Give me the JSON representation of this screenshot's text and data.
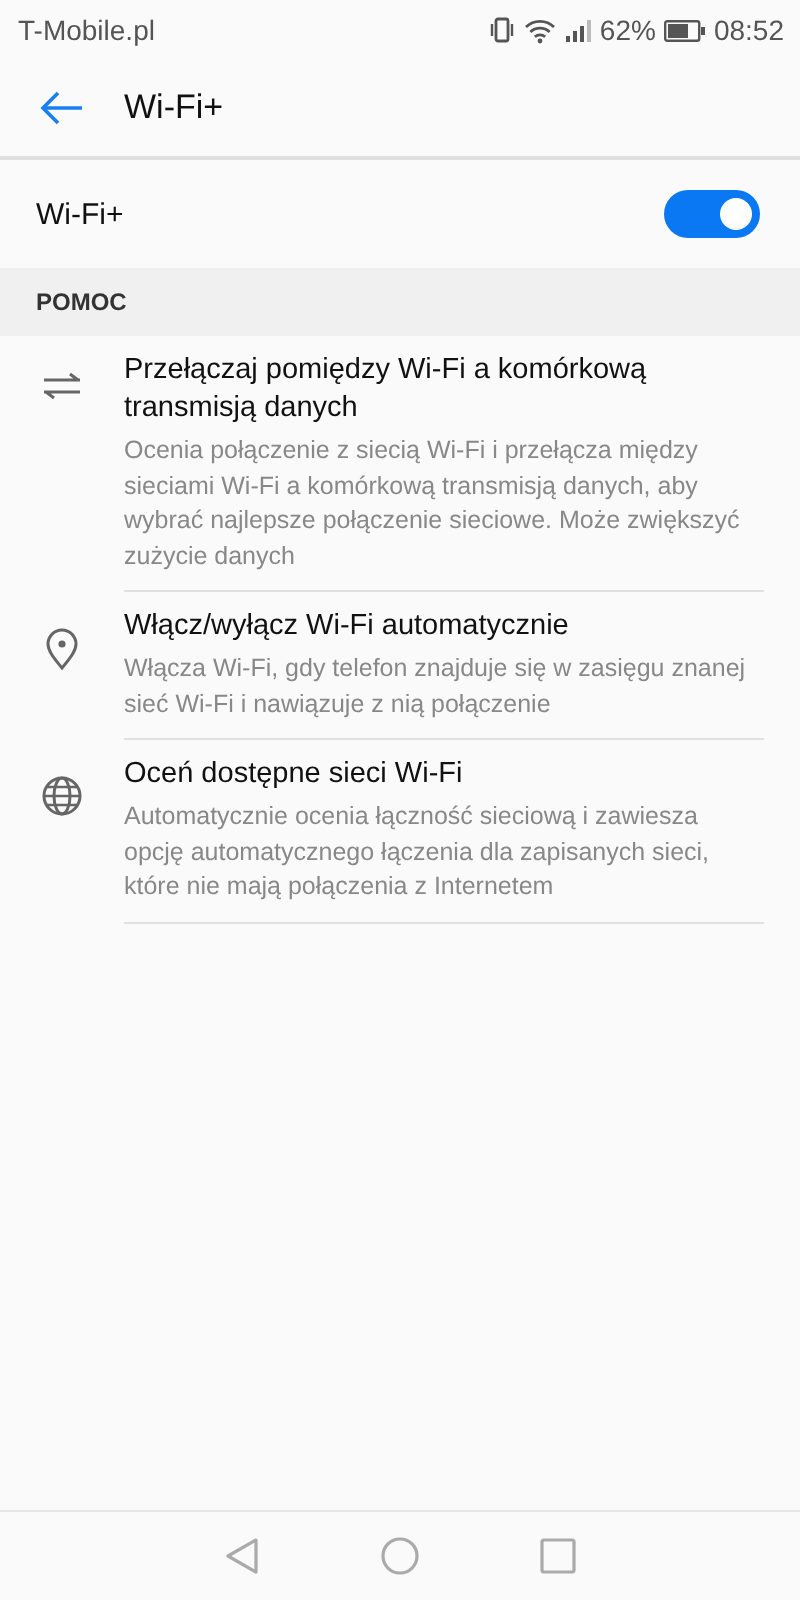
{
  "status_bar": {
    "carrier": "T-Mobile.pl",
    "battery": "62%",
    "time": "08:52"
  },
  "header": {
    "title": "Wi-Fi+"
  },
  "toggle_row": {
    "label": "Wi-Fi+",
    "on": true
  },
  "section": {
    "title": "POMOC"
  },
  "items": [
    {
      "kind": "swap",
      "title": "Przełączaj pomiędzy Wi-Fi a komórkową transmisją danych",
      "description": "Ocenia połączenie z siecią Wi-Fi i przełącza między sieciami Wi-Fi a komórkową transmisją danych, aby wybrać najlepsze połączenie sieciowe. Może zwiększyć zużycie danych"
    },
    {
      "kind": "location",
      "title": "Włącz/wyłącz Wi-Fi automatycznie",
      "description": "Włącza Wi-Fi, gdy telefon znajduje się w zasięgu znanej sieć Wi-Fi i nawiązuje z nią połączenie"
    },
    {
      "kind": "globe",
      "title": "Oceń dostępne sieci Wi-Fi",
      "description": "Automatycznie ocenia łączność sieciową i zawiesza opcję automatycznego łączenia dla zapisanych sieci, które nie mają połączenia z Internetem"
    }
  ]
}
